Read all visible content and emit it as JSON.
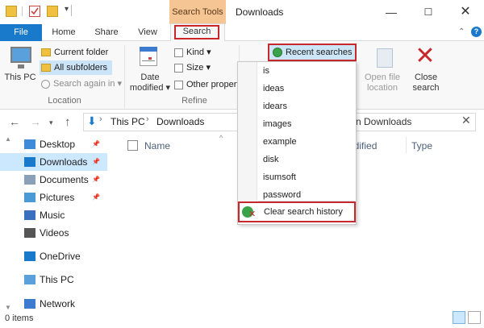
{
  "titlebar": {
    "context_tab": "Search Tools",
    "title": "Downloads",
    "minimize": "—",
    "maximize": "☐",
    "close": "✕"
  },
  "tabs": {
    "file": "File",
    "home": "Home",
    "share": "Share",
    "view": "View",
    "search": "Search"
  },
  "ribbon": {
    "this_pc": "This PC",
    "current_folder": "Current folder",
    "all_subfolders": "All subfolders",
    "search_again_in": "Search again in",
    "group_location": "Location",
    "date_modified": "Date modified",
    "kind": "Kind",
    "size": "Size",
    "other_properties": "Other propert",
    "group_refine": "Refine",
    "recent_searches": "Recent searches",
    "open_file_location": "Open file location",
    "close_search": "Close search"
  },
  "dropdown": {
    "items": [
      "is",
      "ideas",
      "idears",
      "images",
      "example",
      "disk",
      "isumsoft",
      "password"
    ],
    "clear": "Clear search history"
  },
  "address": {
    "this_pc": "This PC",
    "downloads": "Downloads",
    "search_text": "n Downloads"
  },
  "nav_pane": {
    "items": [
      {
        "label": "Desktop",
        "pinned": true
      },
      {
        "label": "Downloads",
        "pinned": true,
        "selected": true
      },
      {
        "label": "Documents",
        "pinned": true
      },
      {
        "label": "Pictures",
        "pinned": true
      },
      {
        "label": "Music",
        "pinned": false
      },
      {
        "label": "Videos",
        "pinned": false
      },
      {
        "label": "OneDrive",
        "pinned": false
      },
      {
        "label": "This PC",
        "pinned": false
      },
      {
        "label": "Network",
        "pinned": false
      }
    ]
  },
  "columns": {
    "name": "Name",
    "modified": "odified",
    "type": "Type"
  },
  "status": {
    "items": "0 items"
  },
  "colors": {
    "accent": "#1979ca",
    "context_tab": "#f5c593",
    "highlight_red": "#c8282c",
    "selected_bg": "#cce8ff"
  }
}
